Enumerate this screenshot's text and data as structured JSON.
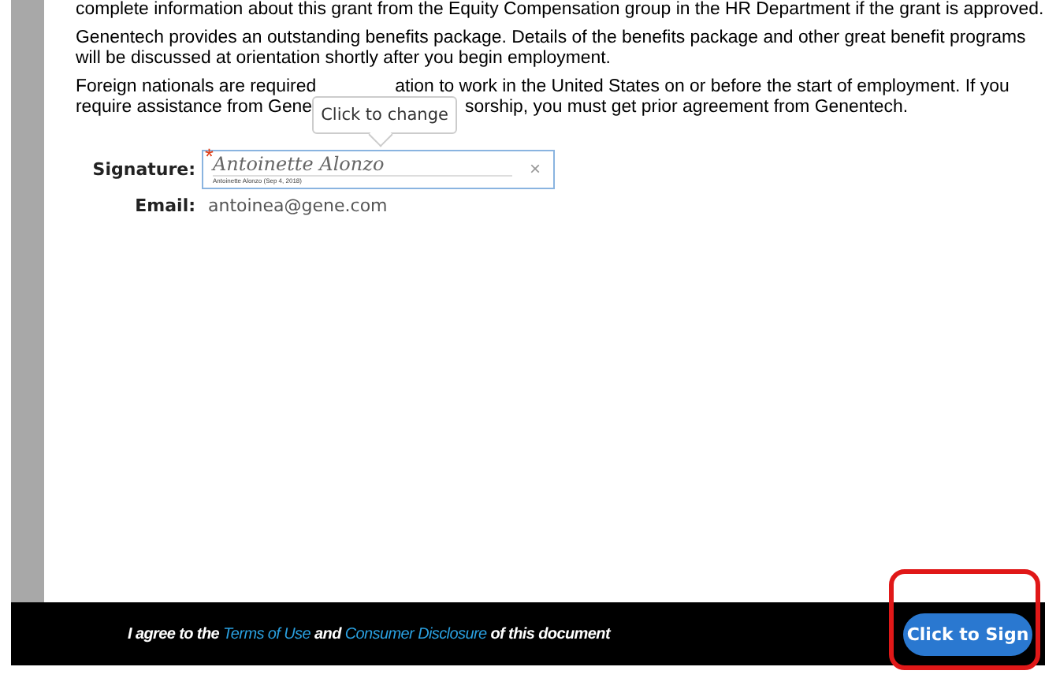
{
  "document": {
    "paragraphs": [
      {
        "kind": "text",
        "text": "complete information about this grant from the Equity Compensation group in the HR Department if the grant is approved."
      },
      {
        "kind": "text",
        "text": "Genentech provides an outstanding benefits package. Details of the benefits package and other great benefit programs will be discussed at orientation shortly after you begin employment."
      },
      {
        "kind": "covered",
        "lines": [
          [
            "Foreign nationals are required",
            "ation to work in the United States on or before the start of employment. If you"
          ],
          [
            "require assistance from Gene",
            "sorship, you must get prior agreement from Genentech."
          ]
        ]
      }
    ],
    "tooltip": "Click to change",
    "signature": {
      "label": "Signature:",
      "required_mark": "*",
      "value": "Antoinette Alonzo",
      "caption": "Antoinette Alonzo  (Sep 4, 2018)",
      "clear": "×"
    },
    "email": {
      "label": "Email:",
      "value": "antoinea@gene.com"
    }
  },
  "footer": {
    "links": [
      "Terms of Use",
      "Consumer Disclosure"
    ],
    "before": "I agree to the",
    "middle": "and",
    "after": "of this document",
    "button": "Click to Sign",
    "highlighted": true
  }
}
